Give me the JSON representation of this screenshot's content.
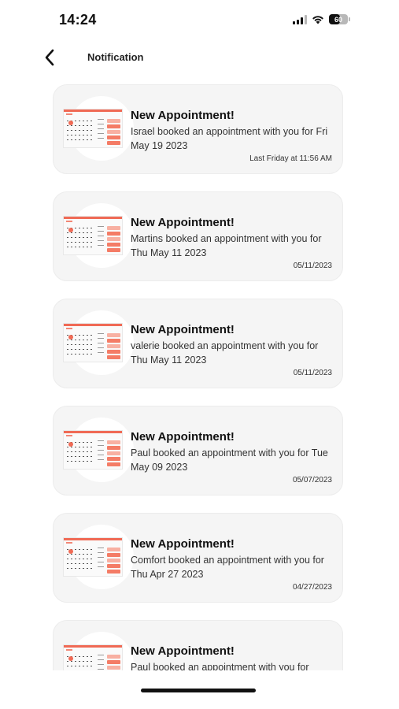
{
  "status_bar": {
    "time": "14:24",
    "battery": "60"
  },
  "header": {
    "title": "Notification",
    "back_icon": "chevron-left-icon"
  },
  "notifications": [
    {
      "title": "New Appointment!",
      "body": "Israel booked an appointment with you for Fri May 19 2023",
      "timestamp": "Last Friday at 11:56 AM"
    },
    {
      "title": "New Appointment!",
      "body": "Martins booked an appointment with you for Thu May 11 2023",
      "timestamp": "05/11/2023"
    },
    {
      "title": "New Appointment!",
      "body": "valerie booked an appointment with you for Thu May 11 2023",
      "timestamp": "05/11/2023"
    },
    {
      "title": "New Appointment!",
      "body": "Paul booked an appointment with you for Tue May 09 2023",
      "timestamp": "05/07/2023"
    },
    {
      "title": "New Appointment!",
      "body": "Comfort booked an appointment with you for Thu Apr 27 2023",
      "timestamp": "04/27/2023"
    },
    {
      "title": "New Appointment!",
      "body": "Paul booked an appointment with you for",
      "timestamp": ""
    }
  ],
  "colors": {
    "accent": "#f06a55",
    "card_bg": "#f5f5f5"
  }
}
